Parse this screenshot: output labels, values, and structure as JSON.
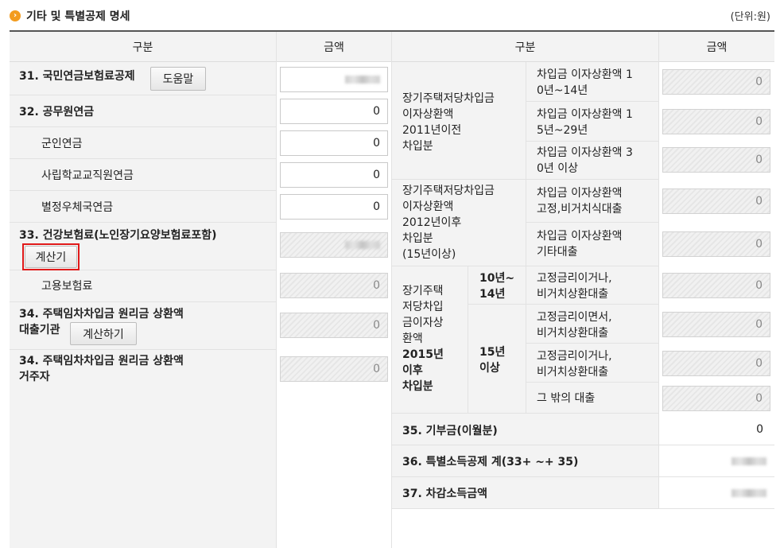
{
  "section": {
    "title": "기타 및 특별공제 명세",
    "unit": "(단위:원)",
    "icon": "arrow-bullet-icon"
  },
  "left": {
    "header_gubun": "구분",
    "header_amount": "금액",
    "rows": {
      "r31": {
        "label": "31. 국민연금보험료공제",
        "button": "도움말"
      },
      "r32": {
        "label": "32. 공무원연금",
        "value": "0"
      },
      "r_mil": {
        "label": "군인연금",
        "value": "0"
      },
      "r_sch": {
        "label": "사립학교교직원연금",
        "value": "0"
      },
      "r_post": {
        "label": "별정우체국연금",
        "value": "0"
      },
      "r33": {
        "label": "33. 건강보험료(노인장기요양보험료포함)",
        "button": "계산기"
      },
      "r_emp": {
        "label": "고용보험료",
        "value": "0"
      },
      "r34a": {
        "label_line1": "34. 주택임차차입금 원리금 상환액",
        "label_line2": "대출기관",
        "button": "계산하기",
        "value": "0"
      },
      "r34b": {
        "label_line1": "34. 주택임차차입금 원리금 상환액",
        "label_line2": "거주자",
        "value": "0"
      }
    }
  },
  "right": {
    "header_gubun": "구분",
    "header_amount": "금액",
    "group2011": {
      "label_lines": [
        "장기주택저당차입금",
        "이자상환액",
        "2011년이전",
        "차입분"
      ],
      "rows": [
        {
          "lines": [
            "차입금 이자상환액 1",
            "0년~14년"
          ],
          "value": "0"
        },
        {
          "lines": [
            "차입금 이자상환액 1",
            "5년~29년"
          ],
          "value": "0"
        },
        {
          "lines": [
            "차입금 이자상환액 3",
            "0년 이상"
          ],
          "value": "0"
        }
      ]
    },
    "group2012": {
      "label_lines": [
        "장기주택저당차입금",
        "이자상환액",
        "2012년이후",
        "차입분",
        "(15년이상)"
      ],
      "rows": [
        {
          "lines": [
            "차입금 이자상환액",
            "고정,비거치식대출"
          ],
          "value": "0"
        },
        {
          "lines": [
            "차입금 이자상환액",
            "기타대출"
          ],
          "value": "0"
        }
      ]
    },
    "group2015": {
      "label_lines": [
        "장기주택",
        "저당차입",
        "금이자상",
        "환액",
        "2015년",
        "이후",
        "차입분"
      ],
      "sub10": [
        "10년~",
        "14년"
      ],
      "sub15": [
        "15년",
        "이상"
      ],
      "rows": [
        {
          "lines": [
            "고정금리이거나,",
            "비거치상환대출"
          ],
          "value": "0"
        },
        {
          "lines": [
            "고정금리이면서,",
            "비거치상환대출"
          ],
          "value": "0"
        },
        {
          "lines": [
            "고정금리이거나,",
            "비거치상환대출"
          ],
          "value": "0"
        },
        {
          "lines": [
            "그 밖의 대출"
          ],
          "value": "0"
        }
      ]
    },
    "r35": {
      "label": "35. 기부금(이월분)",
      "value": "0"
    },
    "r36": {
      "label": "36. 특별소득공제 계(33+ ~+ 35)"
    },
    "r37": {
      "label": "37. 차감소득금액"
    }
  }
}
